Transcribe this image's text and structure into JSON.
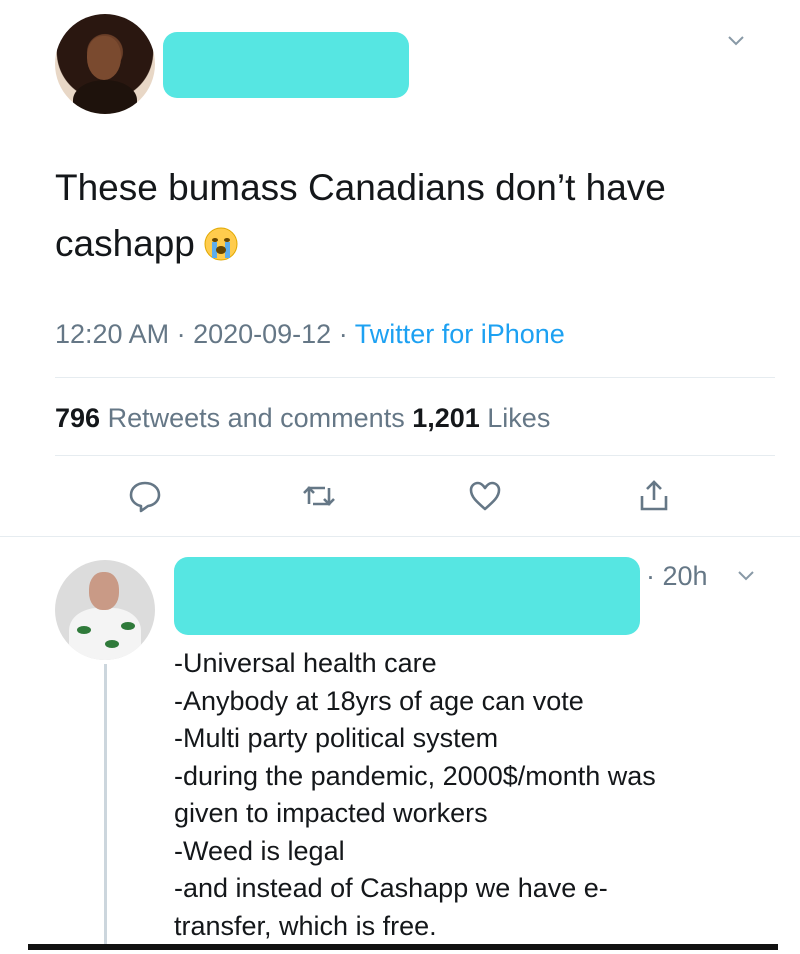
{
  "tweet": {
    "text": "These bumass Canadians don’t have cashapp",
    "emoji": "loudly-crying-face-emoji",
    "time": "12:20 AM",
    "date": "2020-09-12",
    "separator": " · ",
    "source": "Twitter for iPhone",
    "retweets_count": "796",
    "retweets_label": " Retweets and comments ",
    "likes_count": "1,201",
    "likes_label": " Likes"
  },
  "actions": {
    "reply_icon": "reply-icon",
    "retweet_icon": "retweet-icon",
    "like_icon": "heart-icon",
    "share_icon": "share-icon"
  },
  "reply": {
    "time": "· 20h",
    "lines": [
      "-Universal health care",
      "-Anybody at 18yrs of age can vote",
      "-Multi party political system",
      "-during the pandemic, 2000$/month was",
      "given to impacted workers",
      "-Weed is legal",
      "-and instead of Cashapp we have e-",
      "transfer, which is free."
    ]
  },
  "colors": {
    "redaction": "#56e6e2",
    "link": "#1da1f2",
    "muted": "#657786",
    "text": "#14171a"
  }
}
